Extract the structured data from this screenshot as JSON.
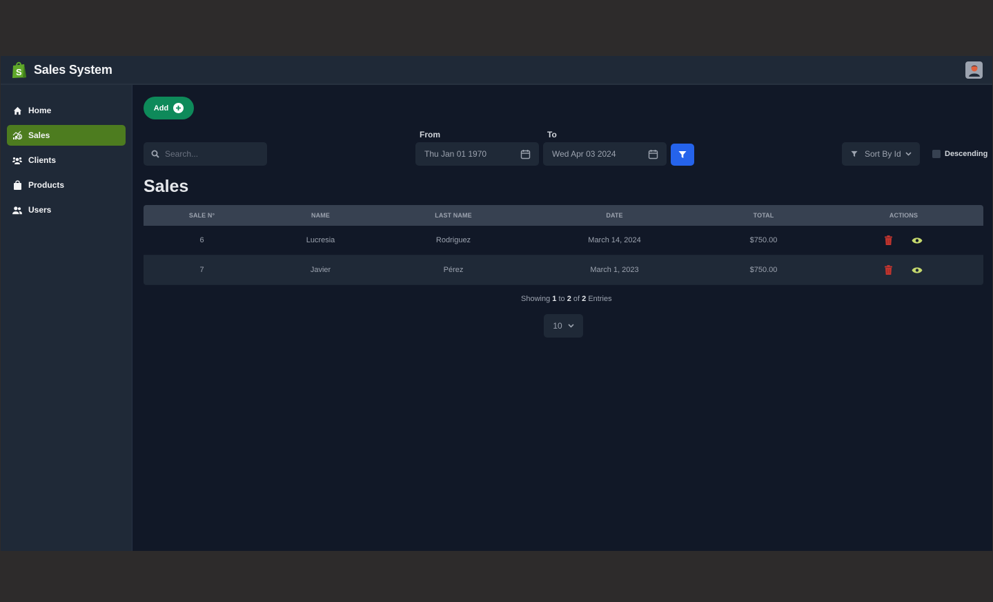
{
  "app": {
    "title": "Sales System",
    "brand_color": "#4d7c1f"
  },
  "sidebar": {
    "items": [
      {
        "label": "Home",
        "icon": "home-icon",
        "active": false
      },
      {
        "label": "Sales",
        "icon": "sales-chart-icon",
        "active": true
      },
      {
        "label": "Clients",
        "icon": "clients-icon",
        "active": false
      },
      {
        "label": "Products",
        "icon": "shopping-bag-icon",
        "active": false
      },
      {
        "label": "Users",
        "icon": "users-icon",
        "active": false
      }
    ]
  },
  "toolbar": {
    "add_label": "Add",
    "search_placeholder": "Search...",
    "from_label": "From",
    "from_value": "Thu Jan 01 1970",
    "to_label": "To",
    "to_value": "Wed Apr 03 2024",
    "sort_label": "Sort By Id",
    "descending_label": "Descending",
    "descending_checked": false
  },
  "page": {
    "title": "Sales"
  },
  "table": {
    "headers": [
      "SALE N°",
      "NAME",
      "LAST NAME",
      "DATE",
      "TOTAL",
      "ACTIONS"
    ],
    "rows": [
      {
        "sale_no": "6",
        "name": "Lucresia",
        "last_name": "Rodriguez",
        "date": "March 14, 2024",
        "total": "$750.00"
      },
      {
        "sale_no": "7",
        "name": "Javier",
        "last_name": "Pérez",
        "date": "March 1, 2023",
        "total": "$750.00"
      }
    ]
  },
  "pagination": {
    "showing_prefix": "Showing",
    "from": "1",
    "to_word": "to",
    "to": "2",
    "of_word": "of",
    "total": "2",
    "suffix": "Entries",
    "page_size": "10"
  },
  "colors": {
    "delete": "#c2352f",
    "view": "#c5d86d",
    "filter_button": "#2563eb",
    "add_button": "#0e8a5a"
  }
}
